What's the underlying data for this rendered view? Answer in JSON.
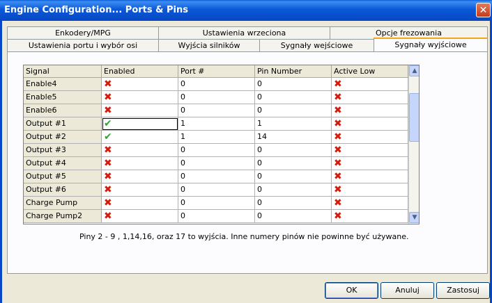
{
  "window": {
    "title": "Engine Configuration... Ports & Pins",
    "close_label": "✕"
  },
  "tabs_row1": [
    "Enkodery/MPG",
    "Ustawienia wrzeciona",
    "Opcje frezowania"
  ],
  "tabs_row2": [
    "Ustawienia portu i wybór osi",
    "Wyjścia silników",
    "Sygnały wejściowe",
    "Sygnały wyjściowe"
  ],
  "active_tab": "Sygnały wyjściowe",
  "table": {
    "columns": [
      "Signal",
      "Enabled",
      "Port #",
      "Pin Number",
      "Active Low"
    ],
    "rows": [
      {
        "signal": "Enable4",
        "enabled": false,
        "port": "0",
        "pin": "0",
        "active_low": false
      },
      {
        "signal": "Enable5",
        "enabled": false,
        "port": "0",
        "pin": "0",
        "active_low": false
      },
      {
        "signal": "Enable6",
        "enabled": false,
        "port": "0",
        "pin": "0",
        "active_low": false
      },
      {
        "signal": "Output #1",
        "enabled": true,
        "port": "1",
        "pin": "1",
        "active_low": false
      },
      {
        "signal": "Output #2",
        "enabled": true,
        "port": "1",
        "pin": "14",
        "active_low": false
      },
      {
        "signal": "Output #3",
        "enabled": false,
        "port": "0",
        "pin": "0",
        "active_low": false
      },
      {
        "signal": "Output #4",
        "enabled": false,
        "port": "0",
        "pin": "0",
        "active_low": false
      },
      {
        "signal": "Output #5",
        "enabled": false,
        "port": "0",
        "pin": "0",
        "active_low": false
      },
      {
        "signal": "Output #6",
        "enabled": false,
        "port": "0",
        "pin": "0",
        "active_low": false
      },
      {
        "signal": "Charge Pump",
        "enabled": false,
        "port": "0",
        "pin": "0",
        "active_low": false
      },
      {
        "signal": "Charge Pump2",
        "enabled": false,
        "port": "0",
        "pin": "0",
        "active_low": false
      }
    ]
  },
  "hint_text": "Piny 2 - 9 , 1,14,16, oraz 17 to wyjścia. Inne numery pinów nie powinne być używane.",
  "buttons": {
    "ok": "OK",
    "cancel": "Anuluj",
    "apply": "Zastosuj"
  },
  "icons": {
    "enabled_true": "check-icon",
    "enabled_false": "x-mark-icon",
    "scroll_up": "scroll-up-icon",
    "scroll_down": "scroll-down-icon"
  }
}
